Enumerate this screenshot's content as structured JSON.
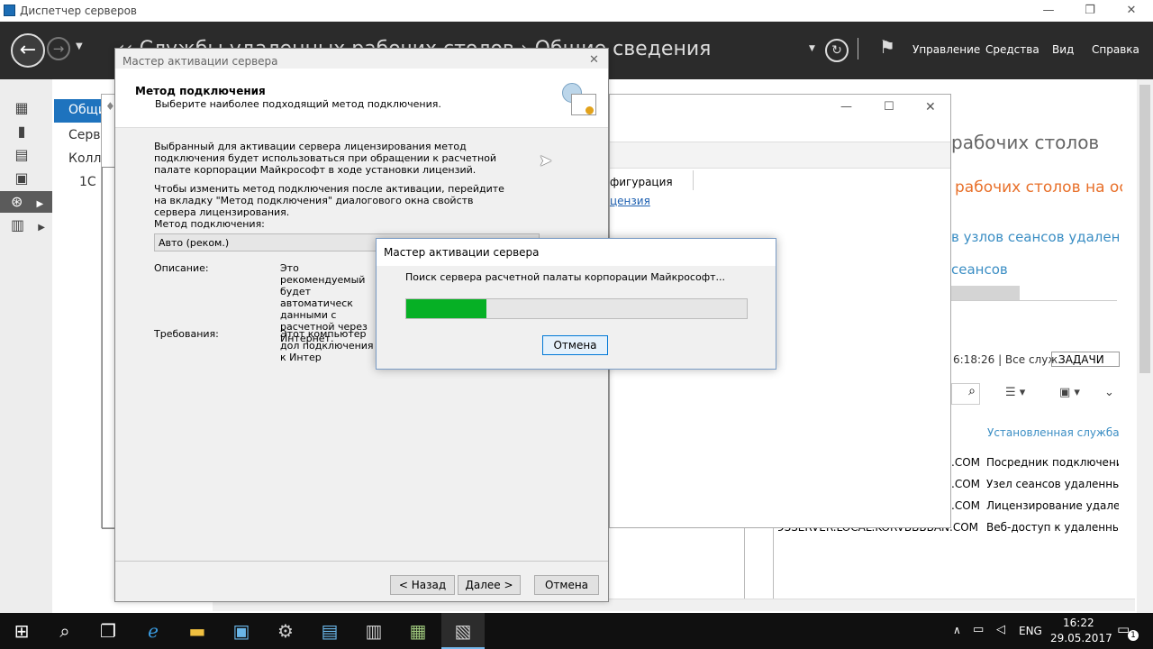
{
  "window": {
    "title": "Диспетчер серверов",
    "min": "—",
    "max": "❐",
    "close": "✕"
  },
  "header": {
    "breadcrumb": "‹‹ Службы удаленных рабочих столов › Общие сведения",
    "menus": [
      "Управление",
      "Средства",
      "Вид",
      "Справка"
    ],
    "refresh_icon": "refresh-icon",
    "flag_icon": "flag-icon"
  },
  "sidebar": {
    "sub_items": [
      "Общи",
      "Серве",
      "Колле",
      "1С"
    ]
  },
  "background": {
    "heading": "рабочих столов",
    "orange": "рабочих столов на ос",
    "blue1": "в узлов сеансов удаленн",
    "blue2": "сеансов",
    "config_tab": "фигурация",
    "license_link": "цензия",
    "timestamp": "6:18:26 | Все служ...",
    "tasks": "ЗАДАЧИ",
    "col_header": "Установленная служба ро",
    "rows": [
      {
        "server": ".COM",
        "role": "Посредник подключений"
      },
      {
        "server": ".COM",
        "role": "Узел сеансов удаленных р"
      },
      {
        "server": ".COM",
        "role": "Лицензирование удаленн"
      },
      {
        "server": "RDSSERVER.LOCAL.KORVBBBBAN.COM",
        "role": "Веб-доступ к удаленным р"
      }
    ]
  },
  "wizard": {
    "title": "Мастер активации сервера",
    "close": "✕",
    "heading": "Метод подключения",
    "subheading": "Выберите наиболее подходящий метод подключения.",
    "para1": "Выбранный для активации сервера лицензирования метод подключения будет использоваться при обращении к расчетной палате корпорации Майкрософт в ходе установки лицензий.",
    "para2": "Чтобы изменить метод подключения после активации, перейдите на вкладку \"Метод подключения\" диалогового окна свойств сервера лицензирования.",
    "method_label": "Метод подключения:",
    "method_value": "Авто (реком.)",
    "desc_label": "Описание:",
    "desc_text": "Это рекомендуемый будет автоматическ данными с расчетной через Интернет.",
    "req_label": "Требования:",
    "req_text": "Этот компьютер дол подключения к Интер",
    "back": "< Назад",
    "next": "Далее >",
    "cancel": "Отмена"
  },
  "progress": {
    "title": "Мастер активации сервера",
    "message": "Поиск сервера расчетной палаты корпорации Майкрософт...",
    "percent": 23.5,
    "cancel": "Отмена"
  },
  "taskbar": {
    "lang": "ENG",
    "time": "16:22",
    "date": "29.05.2017",
    "notifications": "1"
  }
}
